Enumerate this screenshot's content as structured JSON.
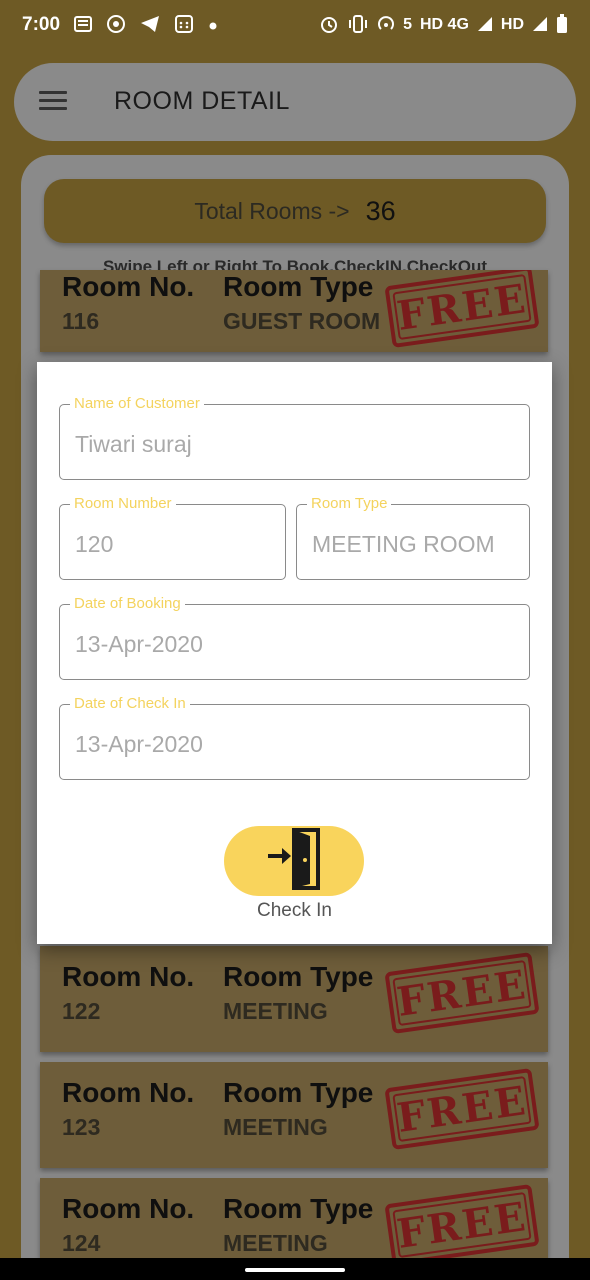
{
  "status_bar": {
    "time": "7:00",
    "network_text": "HD 4G",
    "hd_text": "HD",
    "icons": [
      "news-icon",
      "whatsapp-icon",
      "telegram-icon",
      "calendar-icon",
      "dot-icon",
      "alarm-icon",
      "vibrate-icon",
      "hotspot-icon",
      "signal-icon",
      "battery-icon"
    ],
    "hotspot_count": "5"
  },
  "app_bar": {
    "title": "ROOM DETAIL"
  },
  "summary": {
    "total_label": "Total Rooms ->",
    "total_value": "36"
  },
  "swipe_hint": "Swipe Left or Right To Book,CheckIN,CheckOut",
  "rooms": [
    {
      "no_label": "Room No.",
      "type_label": "Room Type",
      "number": "116",
      "type": "GUEST ROOM",
      "status": "FREE"
    },
    {
      "no_label": "Room No.",
      "type_label": "Room Type",
      "number": "122",
      "type": "MEETING",
      "status": "FREE"
    },
    {
      "no_label": "Room No.",
      "type_label": "Room Type",
      "number": "123",
      "type": "MEETING",
      "status": "FREE"
    },
    {
      "no_label": "Room No.",
      "type_label": "Room Type",
      "number": "124",
      "type": "MEETING",
      "status": "FREE"
    }
  ],
  "dialog": {
    "customer_label": "Name of Customer",
    "customer_value": "Tiwari suraj",
    "room_number_label": "Room Number",
    "room_number_value": "120",
    "room_type_label": "Room Type",
    "room_type_value": "MEETING ROOM",
    "booking_date_label": "Date of Booking",
    "booking_date_value": "13-Apr-2020",
    "checkin_date_label": "Date of Check In",
    "checkin_date_value": "13-Apr-2020",
    "checkin_button_label": "Check In"
  },
  "colors": {
    "background": "#6e5a25",
    "accent": "#f9d45c",
    "stamp": "#7a1c1c"
  }
}
